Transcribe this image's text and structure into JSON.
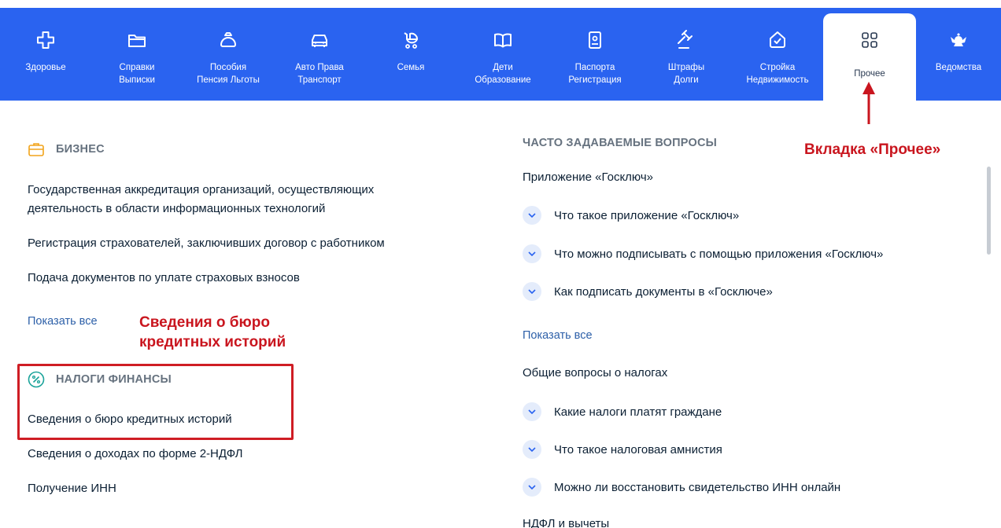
{
  "nav": {
    "items": [
      {
        "icon": "cross-health-icon",
        "label": "Здоровье"
      },
      {
        "icon": "folder-icon",
        "label": "Справки\nВыписки"
      },
      {
        "icon": "wallet-icon",
        "label": "Пособия\nПенсия Льготы"
      },
      {
        "icon": "car-icon",
        "label": "Авто Права\nТранспорт"
      },
      {
        "icon": "stroller-icon",
        "label": "Семья"
      },
      {
        "icon": "book-icon",
        "label": "Дети\nОбразование"
      },
      {
        "icon": "passport-icon",
        "label": "Паспорта\nРегистрация"
      },
      {
        "icon": "gavel-icon",
        "label": "Штрафы\nДолги"
      },
      {
        "icon": "house-check-icon",
        "label": "Стройка\nНедвижимость"
      },
      {
        "icon": "grid-icon",
        "label": "Прочее",
        "active": true
      },
      {
        "icon": "eagle-emblem-icon",
        "label": "Ведомства"
      }
    ],
    "accent_color": "#2a63f0"
  },
  "business": {
    "title": "БИЗНЕС",
    "items": [
      "Государственная аккредитация организаций, осуществляющих деятельность в области информационных технологий",
      "Регистрация страхователей, заключивших договор с работником",
      "Подача документов по уплате страховых взносов"
    ],
    "show_all": "Показать все"
  },
  "taxes": {
    "title": "НАЛОГИ ФИНАНСЫ",
    "items": [
      "Сведения о бюро кредитных историй",
      "Сведения о доходах по форме 2-НДФЛ",
      "Получение ИНН"
    ]
  },
  "faq": {
    "title": "ЧАСТО ЗАДАВАЕМЫЕ ВОПРОСЫ",
    "groups": [
      {
        "title": "Приложение «Госключ»",
        "questions": [
          "Что такое приложение «Госключ»",
          "Что можно подписывать с помощью приложения «Госключ»",
          "Как подписать документы в «Госключе»"
        ]
      },
      {
        "title": "Общие вопросы о налогах",
        "questions": [
          "Какие налоги платят граждане",
          "Что такое налоговая амнистия",
          "Можно ли восстановить свидетельство ИНН онлайн"
        ]
      },
      {
        "title": "НДФЛ и вычеты",
        "questions": []
      }
    ],
    "show_all": "Показать все"
  },
  "annotations": {
    "tab_label": "Вкладка «Прочее»",
    "credit_label": "Сведения о бюро\nкредитных историй",
    "color": "#c9151e"
  }
}
